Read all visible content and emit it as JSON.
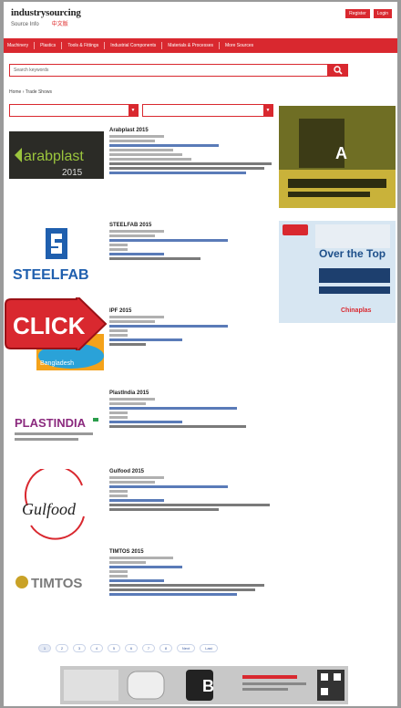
{
  "header": {
    "logo_title": "industrysourcing",
    "logo_tagline": "Source Info",
    "logo_tagline_red": "中文版",
    "links": [
      "Register",
      "Login"
    ]
  },
  "nav": {
    "items": [
      "Machinery",
      "Plastics",
      "Tools & Fittings",
      "Industrial Components",
      "Materials & Processes",
      "More Sources"
    ]
  },
  "search": {
    "placeholder": "Search keywords"
  },
  "breadcrumb": "Home › Trade Shows",
  "listings": [
    {
      "title": "Arabplast 2015",
      "logo_text": "arabplast",
      "logo_year": "2015"
    },
    {
      "title": "STEELFAB 2015",
      "logo_text": "STEELFAB"
    },
    {
      "title": "IPF 2015",
      "logo_text": "Bangladesh"
    },
    {
      "title": "PlastIndia 2015",
      "logo_text": "PLASTINDIA"
    },
    {
      "title": "Gulfood 2015",
      "logo_text": "Gulfood"
    },
    {
      "title": "TIMTOS 2015",
      "logo_text": "TIMTOS"
    }
  ],
  "ads": [
    {
      "label": "A"
    },
    {
      "headline": "Over the Top",
      "brand": "Chinaplas"
    }
  ],
  "click_badge": "CLICK",
  "pagination": [
    "1",
    "2",
    "3",
    "4",
    "5",
    "6",
    "7",
    "8",
    "Next",
    "Last"
  ],
  "bottom_banner_label": "B",
  "colors": {
    "brand_red": "#d9282f",
    "link_blue": "#5a7bb8"
  }
}
